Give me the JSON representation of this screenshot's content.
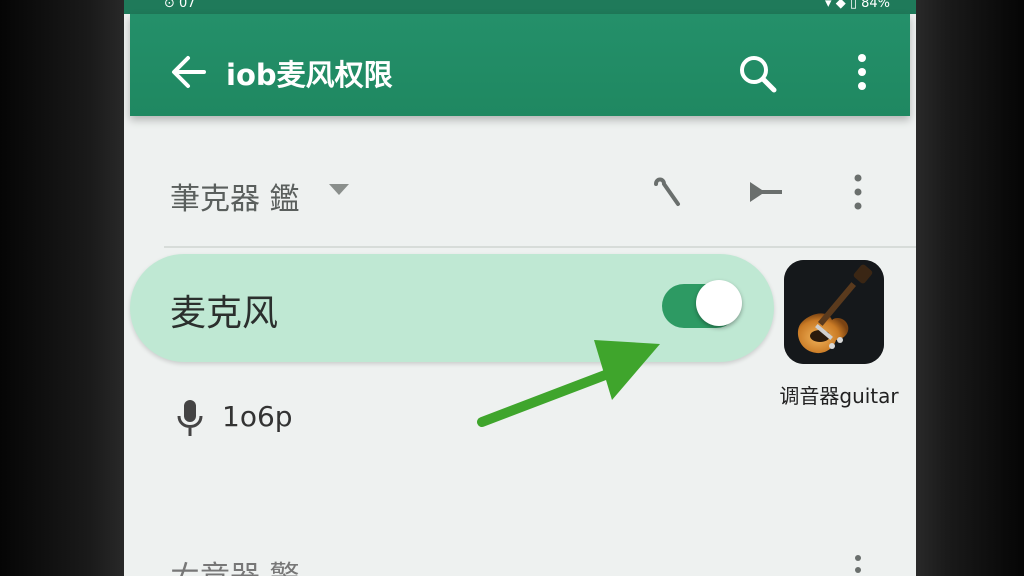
{
  "statusbar": {
    "left": "⊙ 07",
    "right": "▾ ◆ ▯ 84%"
  },
  "appbar": {
    "title": "iob麦风权限",
    "back_icon": "arrow-left-icon",
    "search_icon": "search-icon",
    "more_icon": "more-vert-icon"
  },
  "section": {
    "title": "茟克器 鑑",
    "caret_icon": "caret-down-icon",
    "wrench_icon": "wrench-icon",
    "flag_icon": "flag-icon",
    "more_icon": "more-vert-icon"
  },
  "mic_permission": {
    "label": "麦克风",
    "enabled": true,
    "accent": "#2d9a63"
  },
  "app": {
    "name": "调音器guitar",
    "icon": "guitar-icon"
  },
  "mic_status": {
    "icon": "microphone-icon",
    "value": "1o6p"
  },
  "next_section": {
    "title": "ㄊ竞器 警 .."
  },
  "colors": {
    "appbar": "#1f8861",
    "row_highlight": "#bfe8d3",
    "arrow": "#3fa52c"
  }
}
